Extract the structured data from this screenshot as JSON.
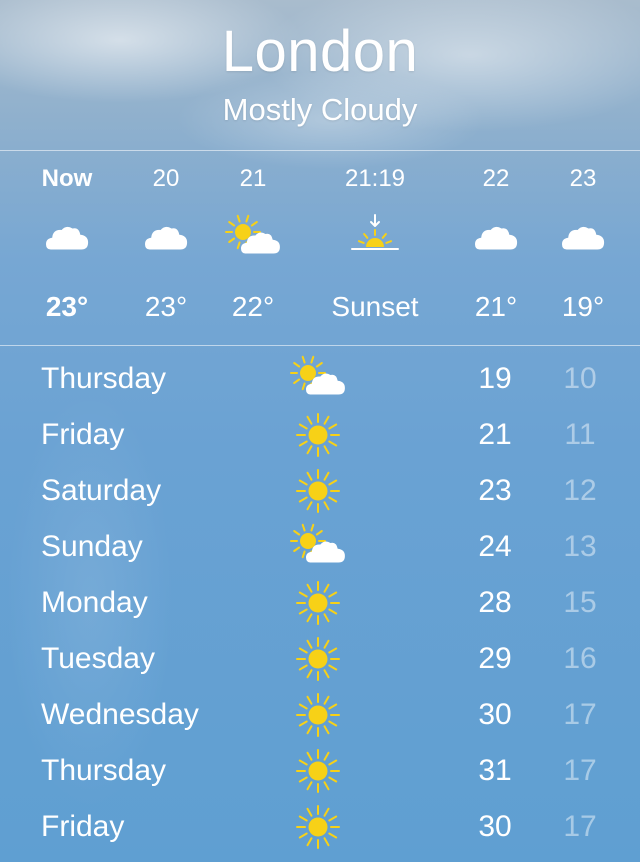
{
  "location": {
    "city": "London",
    "condition": "Mostly Cloudy"
  },
  "hourly": [
    {
      "time": "Now",
      "icon": "cloud-icon",
      "temp": "23°",
      "bold": true
    },
    {
      "time": "20",
      "icon": "cloud-icon",
      "temp": "23°"
    },
    {
      "time": "21",
      "icon": "partly-sunny-icon",
      "temp": "22°"
    },
    {
      "time": "21:19",
      "icon": "sunset-icon",
      "temp": "Sunset"
    },
    {
      "time": "22",
      "icon": "cloud-icon",
      "temp": "21°"
    },
    {
      "time": "23",
      "icon": "cloud-icon",
      "temp": "19°"
    }
  ],
  "daily": [
    {
      "day": "Thursday",
      "icon": "partly-sunny-icon",
      "high": "19",
      "low": "10"
    },
    {
      "day": "Friday",
      "icon": "sun-icon",
      "high": "21",
      "low": "11"
    },
    {
      "day": "Saturday",
      "icon": "sun-icon",
      "high": "23",
      "low": "12"
    },
    {
      "day": "Sunday",
      "icon": "partly-sunny-icon",
      "high": "24",
      "low": "13"
    },
    {
      "day": "Monday",
      "icon": "sun-icon",
      "high": "28",
      "low": "15"
    },
    {
      "day": "Tuesday",
      "icon": "sun-icon",
      "high": "29",
      "low": "16"
    },
    {
      "day": "Wednesday",
      "icon": "sun-icon",
      "high": "30",
      "low": "17"
    },
    {
      "day": "Thursday",
      "icon": "sun-icon",
      "high": "31",
      "low": "17"
    },
    {
      "day": "Friday",
      "icon": "sun-icon",
      "high": "30",
      "low": "17"
    }
  ],
  "colors": {
    "sun": "#f7d117",
    "cloud": "#ffffff",
    "low_temp": "#ffffff73"
  }
}
